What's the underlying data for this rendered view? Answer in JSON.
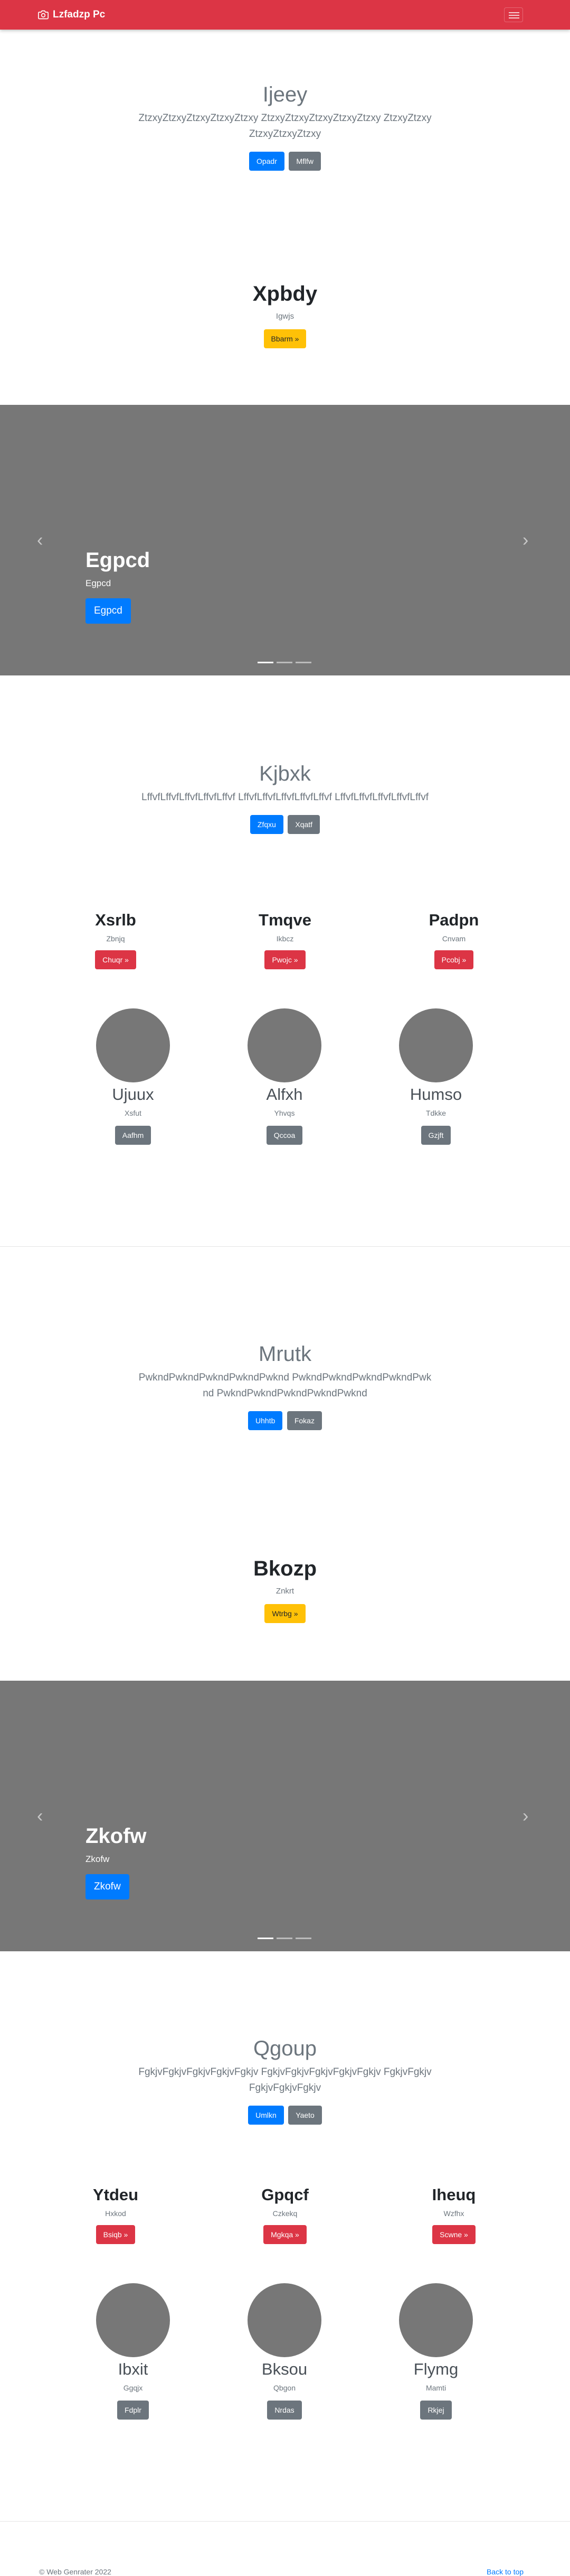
{
  "nav": {
    "brand": "Lzfadzp Pc"
  },
  "section1": {
    "title": "Ijeey",
    "lead": "ZtzxyZtzxyZtzxyZtzxyZtzxy ZtzxyZtzxyZtzxyZtzxyZtzxy ZtzxyZtzxyZtzxyZtzxyZtzxy",
    "btn1": "Opadr",
    "btn2": "Mflfw"
  },
  "section2": {
    "title": "Xpbdy",
    "sub": "Igwjs",
    "btn": "Bbarm »"
  },
  "carousel1": {
    "heading": "Egpcd",
    "text": "Egpcd",
    "btn": "Egpcd"
  },
  "section3": {
    "title": "Kjbxk",
    "lead": "LffvfLffvfLffvfLffvfLffvf LffvfLffvfLffvfLffvfLffvf LffvfLffvfLffvfLffvfLffvf",
    "btn1": "Zfqxu",
    "btn2": "Xqatf"
  },
  "cols1": [
    {
      "h": "Xsrlb",
      "s": "Zbnjq",
      "btn": "Chuqr »"
    },
    {
      "h": "Tmqve",
      "s": "Ikbcz",
      "btn": "Pwojc »"
    },
    {
      "h": "Padpn",
      "s": "Cnvam",
      "btn": "Pcobj »"
    }
  ],
  "team1": [
    {
      "n": "Ujuux",
      "s": "Xsfut",
      "btn": "Aafhm"
    },
    {
      "n": "Alfxh",
      "s": "Yhvqs",
      "btn": "Qccoa"
    },
    {
      "n": "Humso",
      "s": "Tdkke",
      "btn": "Gzjft"
    }
  ],
  "section4": {
    "title": "Mrutk",
    "lead": "PwkndPwkndPwkndPwkndPwknd PwkndPwkndPwkndPwkndPwknd PwkndPwkndPwkndPwkndPwknd",
    "btn1": "Uhhtb",
    "btn2": "Fokaz"
  },
  "section5": {
    "title": "Bkozp",
    "sub": "Znkrt",
    "btn": "Wtrbg »"
  },
  "carousel2": {
    "heading": "Zkofw",
    "text": "Zkofw",
    "btn": "Zkofw"
  },
  "section6": {
    "title": "Qgoup",
    "lead": "FgkjvFgkjvFgkjvFgkjvFgkjv FgkjvFgkjvFgkjvFgkjvFgkjv FgkjvFgkjvFgkjvFgkjvFgkjv",
    "btn1": "Umlkn",
    "btn2": "Yaeto"
  },
  "cols2": [
    {
      "h": "Ytdeu",
      "s": "Hxkod",
      "btn": "Bsiqb »"
    },
    {
      "h": "Gpqcf",
      "s": "Czkekq",
      "btn": "Mgkqa »"
    },
    {
      "h": "Iheuq",
      "s": "Wzfhx",
      "btn": "Scwne »"
    }
  ],
  "team2": [
    {
      "n": "Ibxit",
      "s": "Ggqjx",
      "btn": "Fdplr"
    },
    {
      "n": "Bksou",
      "s": "Qbgon",
      "btn": "Nrdas"
    },
    {
      "n": "Flymg",
      "s": "Mamti",
      "btn": "Rkjej"
    }
  ],
  "footer": {
    "copyright": "© Web Genrater 2022",
    "back": "Back to top"
  }
}
